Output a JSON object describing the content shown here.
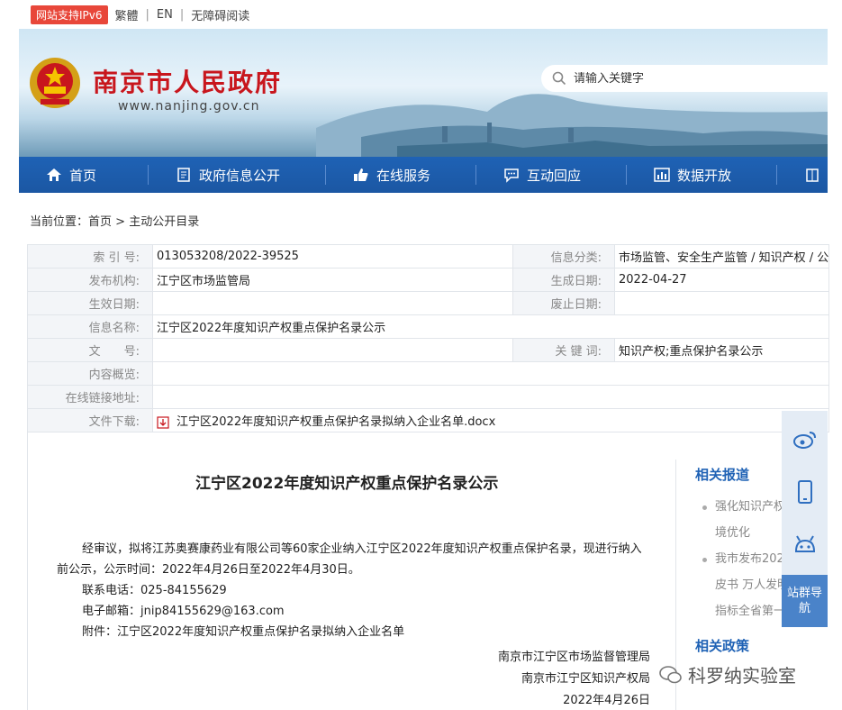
{
  "topbar": {
    "ipv6": "网站支持IPv6",
    "links": [
      "繁體",
      "EN",
      "无障碍阅读"
    ]
  },
  "header": {
    "site_title": "南京市人民政府",
    "site_url": "www.nanjing.gov.cn",
    "search_placeholder": "请输入关键字"
  },
  "nav": {
    "items": [
      "首页",
      "政府信息公开",
      "在线服务",
      "互动回应",
      "数据开放"
    ]
  },
  "breadcrumb": {
    "prefix": "当前位置：",
    "home": "首页",
    "sep": ">",
    "current": "主动公开目录"
  },
  "info": {
    "index_label": "索 引 号:",
    "index_value": "013053208/2022-39525",
    "category_label": "信息分类:",
    "category_value": "市场监管、安全生产监管 / 知识产权 / 公",
    "publisher_label": "发布机构:",
    "publisher_value": "江宁区市场监管局",
    "created_label": "生成日期:",
    "created_value": "2022-04-27",
    "effective_label": "生效日期:",
    "effective_value": "",
    "expired_label": "废止日期:",
    "expired_value": "",
    "name_label": "信息名称:",
    "name_value": "江宁区2022年度知识产权重点保护名录公示",
    "docno_label": "文　　号:",
    "docno_value": "",
    "keywords_label": "关 键 词:",
    "keywords_value": "知识产权;重点保护名录公示",
    "summary_label": "内容概览:",
    "summary_value": "",
    "link_label": "在线链接地址:",
    "link_value": "",
    "download_label": "文件下载:",
    "download_value": "江宁区2022年度知识产权重点保护名录拟纳入企业名单.docx"
  },
  "article": {
    "title": "江宁区2022年度知识产权重点保护名录公示",
    "para1_line1": "经审议，拟将江苏奥赛康药业有限公司等60家企业纳入江宁区2022年度知识产权重点保护名录，现进行纳入",
    "para1_line2": "前公示，公示时间：2022年4月26日至2022年4月30日。",
    "phone": "联系电话：025-84155629",
    "email": "电子邮箱：jnip84155629@163.com",
    "attachment": "附件：江宁区2022年度知识产权重点保护名录拟纳入企业名单",
    "sig1": "南京市江宁区市场监督管理局",
    "sig2": "南京市江宁区知识产权局",
    "date": "2022年4月26日"
  },
  "sidebar": {
    "related_reports": "相关报道",
    "reports": [
      "强化知识产权",
      "境优化",
      "我市发布202",
      "皮书 万人发明",
      "指标全省第一"
    ],
    "related_policies": "相关政策"
  },
  "float": {
    "guide": "站群导航"
  },
  "watermark": "科罗纳实验室",
  "colors": {
    "brand_red": "#c8161d",
    "nav_blue": "#1f62b5",
    "ipv6_red": "#e8473a"
  }
}
